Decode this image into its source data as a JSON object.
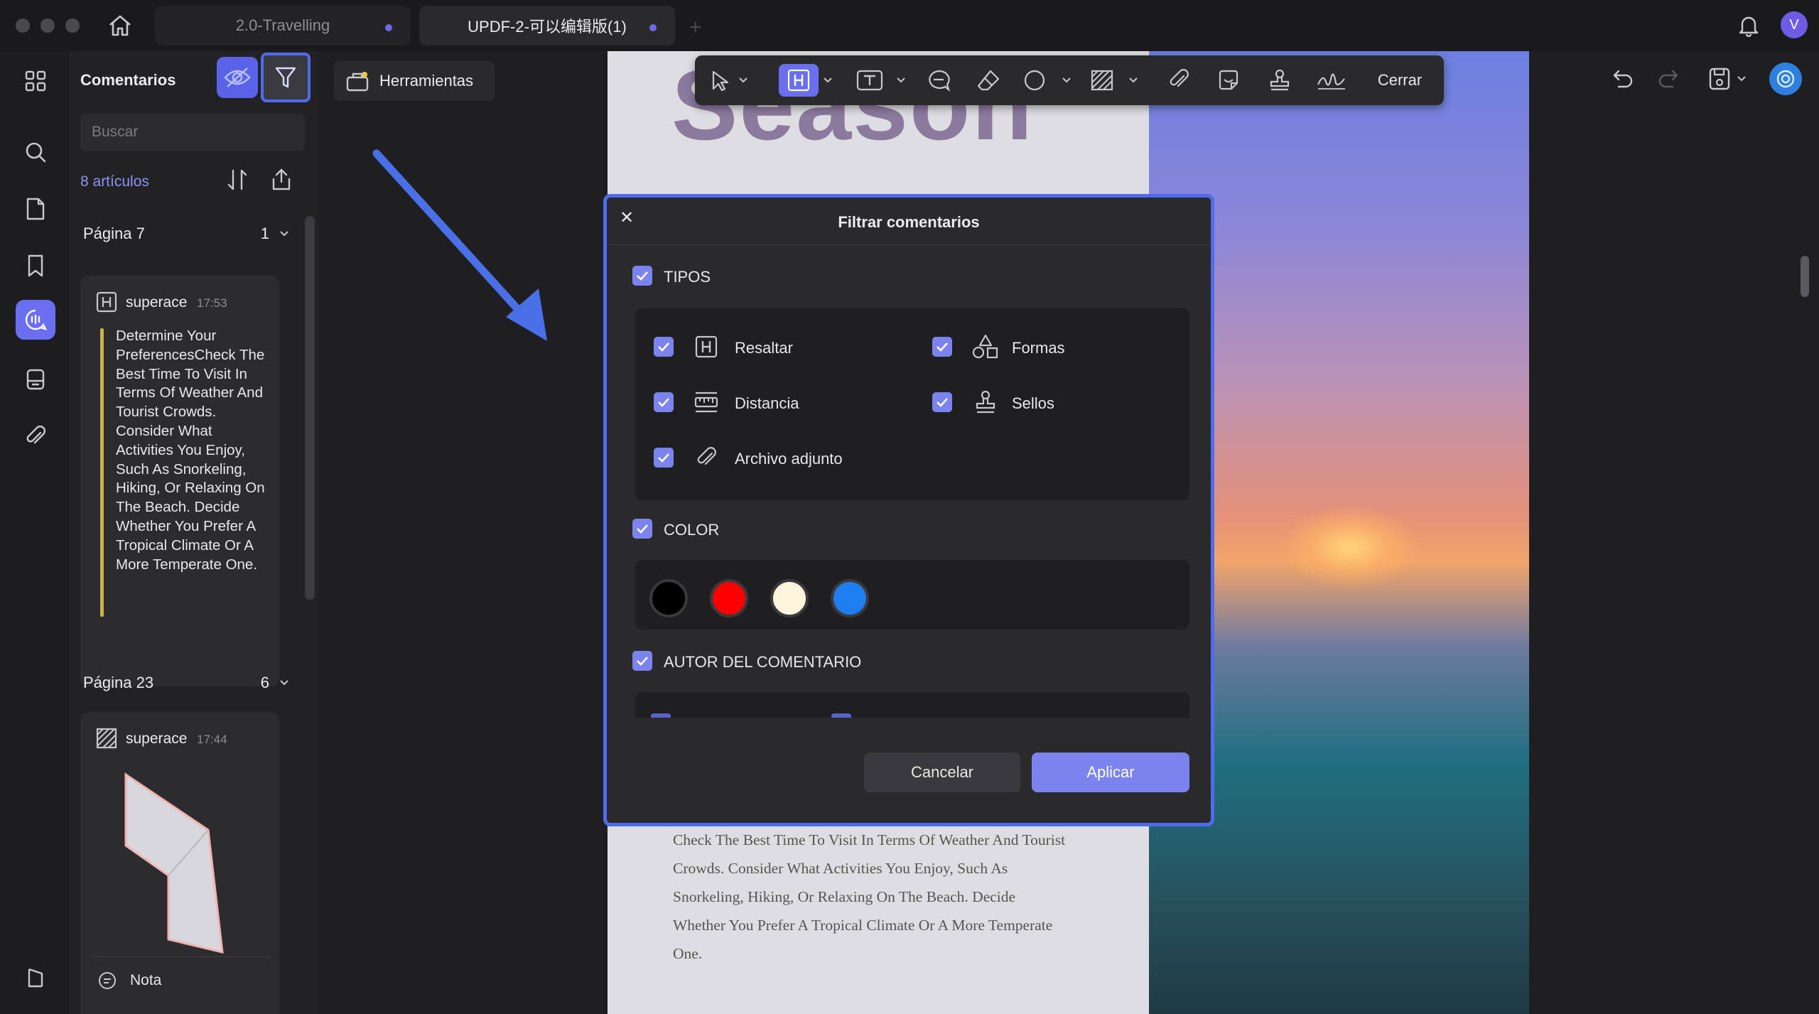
{
  "tabs": [
    {
      "label": "2.0-Travelling"
    },
    {
      "label": "UPDF-2-可以编辑版(1)"
    }
  ],
  "user": {
    "avatar_letter": "V"
  },
  "sidebar": {
    "title": "Comentarios",
    "search_placeholder": "Buscar",
    "count_label": "8 artículos",
    "tools_label": "Herramientas",
    "groups": [
      {
        "page_label": "Página 7",
        "count": "1",
        "comments": [
          {
            "author": "superace",
            "time": "17:53",
            "icon": "highlight-icon",
            "text": "Determine Your PreferencesCheck The Best Time To Visit In Terms Of Weather And Tourist Crowds. Consider What Activities You Enjoy, Such As Snorkeling, Hiking, Or Relaxing On The Beach. Decide Whether You Prefer A Tropical Climate Or A More Temperate One."
          }
        ]
      },
      {
        "page_label": "Página 23",
        "count": "6",
        "comments": [
          {
            "author": "superace",
            "time": "17:44",
            "icon": "area-icon"
          },
          {
            "author": "Nota",
            "icon": "note-icon"
          }
        ]
      }
    ]
  },
  "toolbar": {
    "close_label": "Cerrar"
  },
  "document": {
    "heading": "Season",
    "body_text": "Check The Best Time To Visit In Terms Of Weather And Tourist Crowds. Consider What Activities You Enjoy, Such As Snorkeling, Hiking, Or Relaxing On The Beach. Decide Whether You Prefer A Tropical Climate Or A More Temperate One."
  },
  "dialog": {
    "title": "Filtrar comentarios",
    "types_header": "TIPOS",
    "types": [
      {
        "label": "Resaltar",
        "icon": "highlight-icon",
        "checked": true
      },
      {
        "label": "Formas",
        "icon": "shapes-icon",
        "checked": true
      },
      {
        "label": "Distancia",
        "icon": "ruler-icon",
        "checked": true
      },
      {
        "label": "Sellos",
        "icon": "stamp-icon",
        "checked": true
      },
      {
        "label": "Archivo adjunto",
        "icon": "paperclip-icon",
        "checked": true
      }
    ],
    "color_header": "COLOR",
    "colors": [
      "#000000",
      "#ff0000",
      "#fff5dc",
      "#1e7ef0"
    ],
    "author_header": "AUTOR DEL COMENTARIO",
    "cancel_label": "Cancelar",
    "apply_label": "Aplicar"
  },
  "accent_color": "#7b83ee",
  "highlight_color": "#4f6bf0"
}
